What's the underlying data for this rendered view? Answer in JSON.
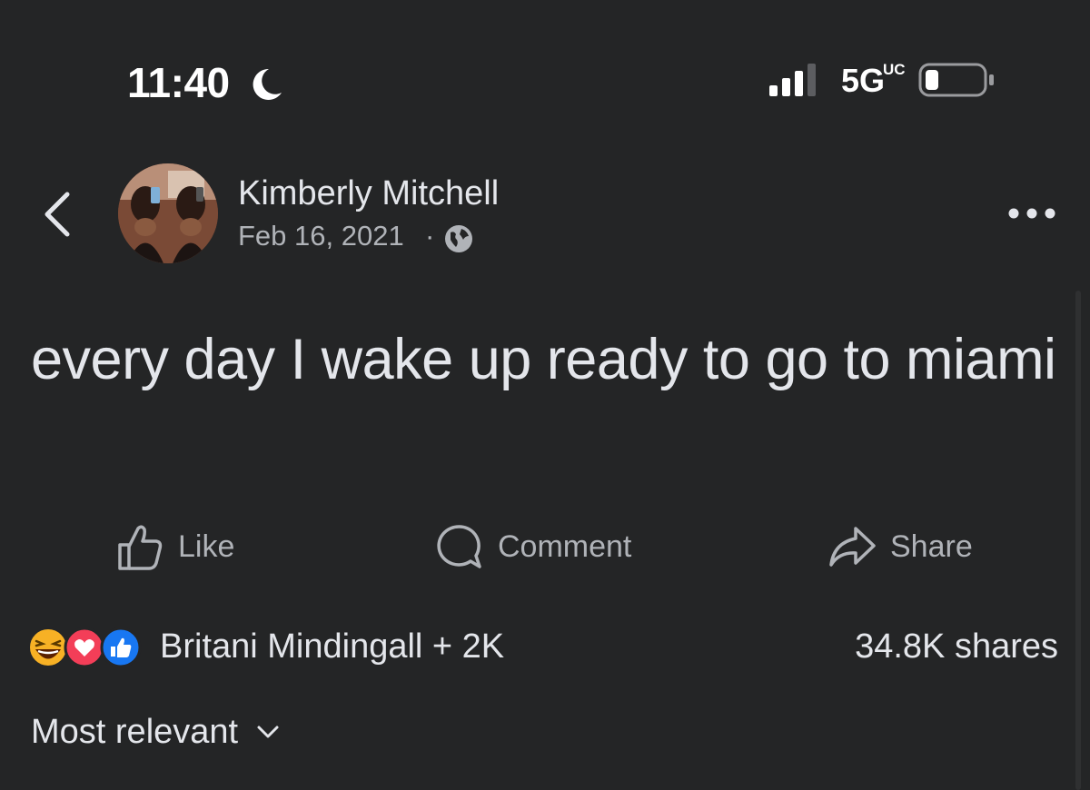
{
  "status_bar": {
    "time": "11:40",
    "network": "5G",
    "network_sub": "UC"
  },
  "post": {
    "author": "Kimberly Mitchell",
    "date": "Feb 16, 2021",
    "separator": "·",
    "text": "every day I wake up ready to go to miami"
  },
  "actions": {
    "like_label": "Like",
    "comment_label": "Comment",
    "share_label": "Share"
  },
  "engagement": {
    "reactors": "Britani Mindingall + 2K",
    "shares": "34.8K shares",
    "reaction_types": [
      "haha",
      "love",
      "like"
    ]
  },
  "comments": {
    "sort_label": "Most relevant"
  },
  "colors": {
    "background": "#242526",
    "primary_text": "#e4e6eb",
    "secondary_text": "#b0b3b8",
    "like_blue": "#1877f2",
    "love_red": "#f33e58",
    "haha_yellow": "#f7b125"
  }
}
